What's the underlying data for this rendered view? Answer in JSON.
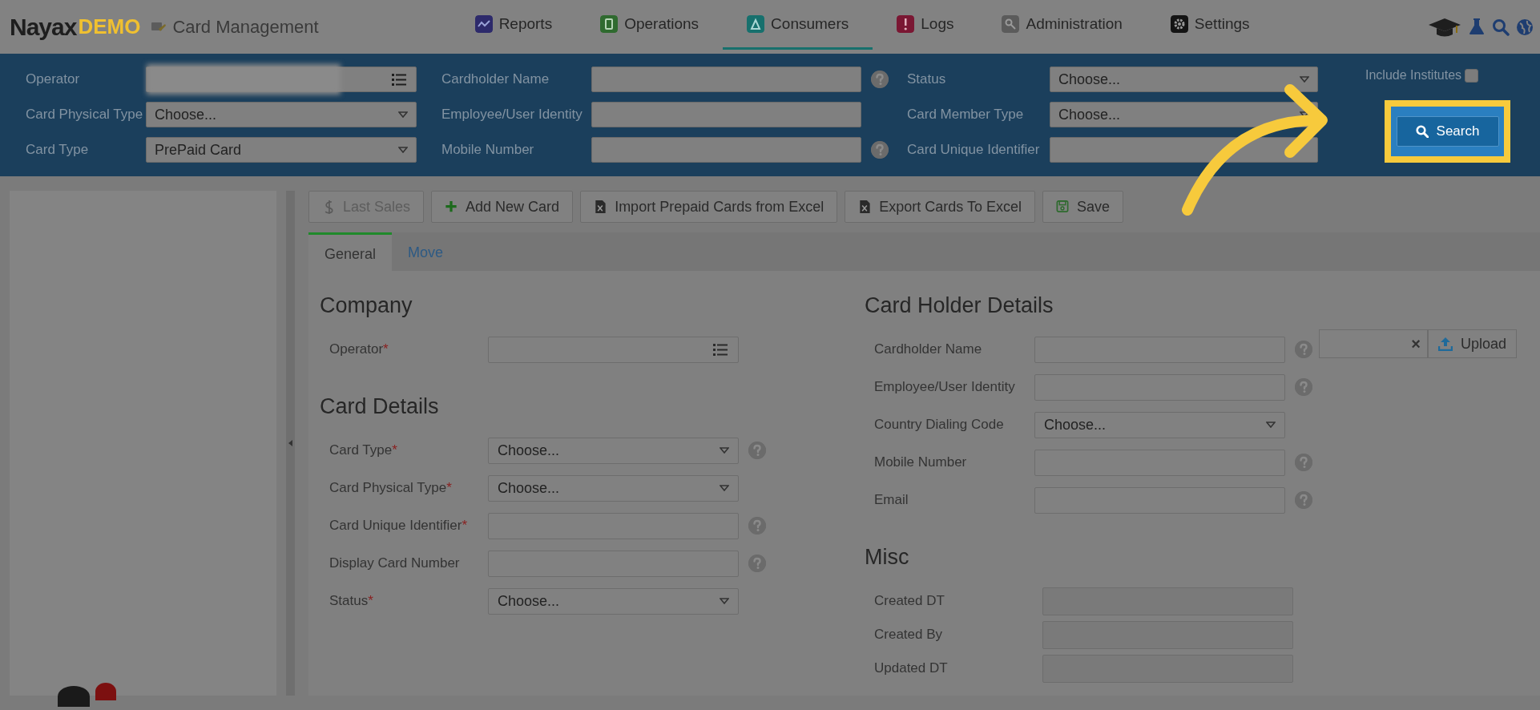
{
  "header": {
    "brand": "Nayax",
    "edition": "DEMO",
    "page_title": "Card Management",
    "nav": [
      {
        "label": "Reports",
        "selected": false
      },
      {
        "label": "Operations",
        "selected": false
      },
      {
        "label": "Consumers",
        "selected": true
      },
      {
        "label": "Logs",
        "selected": false
      },
      {
        "label": "Administration",
        "selected": false
      },
      {
        "label": "Settings",
        "selected": false
      }
    ]
  },
  "filters": {
    "fields": [
      {
        "label": "Operator",
        "kind": "lookup",
        "redacted": true
      },
      {
        "label": "Cardholder Name",
        "kind": "text",
        "help": true
      },
      {
        "label": "Status",
        "kind": "select",
        "value": "Choose..."
      },
      {
        "label": "Card Physical Type",
        "kind": "select",
        "value": "Choose..."
      },
      {
        "label": "Employee/User Identity",
        "kind": "text",
        "help": false
      },
      {
        "label": "Card Member Type",
        "kind": "select",
        "value": "Choose..."
      },
      {
        "label": "Card Type",
        "kind": "select",
        "value": "PrePaid Card"
      },
      {
        "label": "Mobile Number",
        "kind": "text",
        "help": true
      },
      {
        "label": "Card Unique Identifier",
        "kind": "text"
      }
    ],
    "include_institutes": {
      "label": "Include Institutes",
      "checked": false
    },
    "search_button": {
      "label": "Search",
      "highlighted": true
    }
  },
  "toolbar": [
    {
      "label": "Last Sales",
      "disabled": true
    },
    {
      "label": "Add New Card",
      "disabled": false
    },
    {
      "label": "Import Prepaid Cards from Excel",
      "disabled": false
    },
    {
      "label": "Export Cards To Excel",
      "disabled": false
    },
    {
      "label": "Save",
      "disabled": false
    }
  ],
  "tabs": [
    {
      "label": "General",
      "selected": true
    },
    {
      "label": "Move",
      "selected": false
    }
  ],
  "left_sections": [
    {
      "title": "Company",
      "fields": [
        {
          "label": "Operator",
          "required_mark": "*",
          "kind": "lookup",
          "help": false
        }
      ]
    },
    {
      "title": "Card Details",
      "fields": [
        {
          "label": "Card Type",
          "required_mark": "*",
          "kind": "select",
          "value": "Choose...",
          "help": true
        },
        {
          "label": "Card Physical Type",
          "required_mark": "*",
          "kind": "select",
          "value": "Choose...",
          "help": false
        },
        {
          "label": "Card Unique Identifier",
          "required_mark": "*",
          "kind": "text",
          "help": true
        },
        {
          "label": "Display Card Number",
          "kind": "text",
          "help": true
        },
        {
          "label": "Status",
          "required_mark": "*",
          "kind": "select",
          "value": "Choose...",
          "help": false
        }
      ]
    }
  ],
  "right_sections": [
    {
      "title": "Card Holder Details",
      "fields": [
        {
          "label": "Cardholder Name",
          "kind": "text",
          "help": true
        },
        {
          "label": "Employee/User Identity",
          "kind": "text",
          "help": true
        },
        {
          "label": "Country Dialing Code",
          "kind": "select",
          "value": "Choose...",
          "help": false
        },
        {
          "label": "Mobile Number",
          "kind": "text",
          "help": true
        },
        {
          "label": "Email",
          "kind": "text",
          "help": true
        }
      ]
    },
    {
      "title": "Misc",
      "fields": [
        {
          "label": "Created DT",
          "kind": "readonly"
        },
        {
          "label": "Created By",
          "kind": "readonly"
        },
        {
          "label": "Updated DT",
          "kind": "readonly"
        }
      ]
    }
  ],
  "upload": {
    "label": "Upload",
    "clear": "×"
  }
}
